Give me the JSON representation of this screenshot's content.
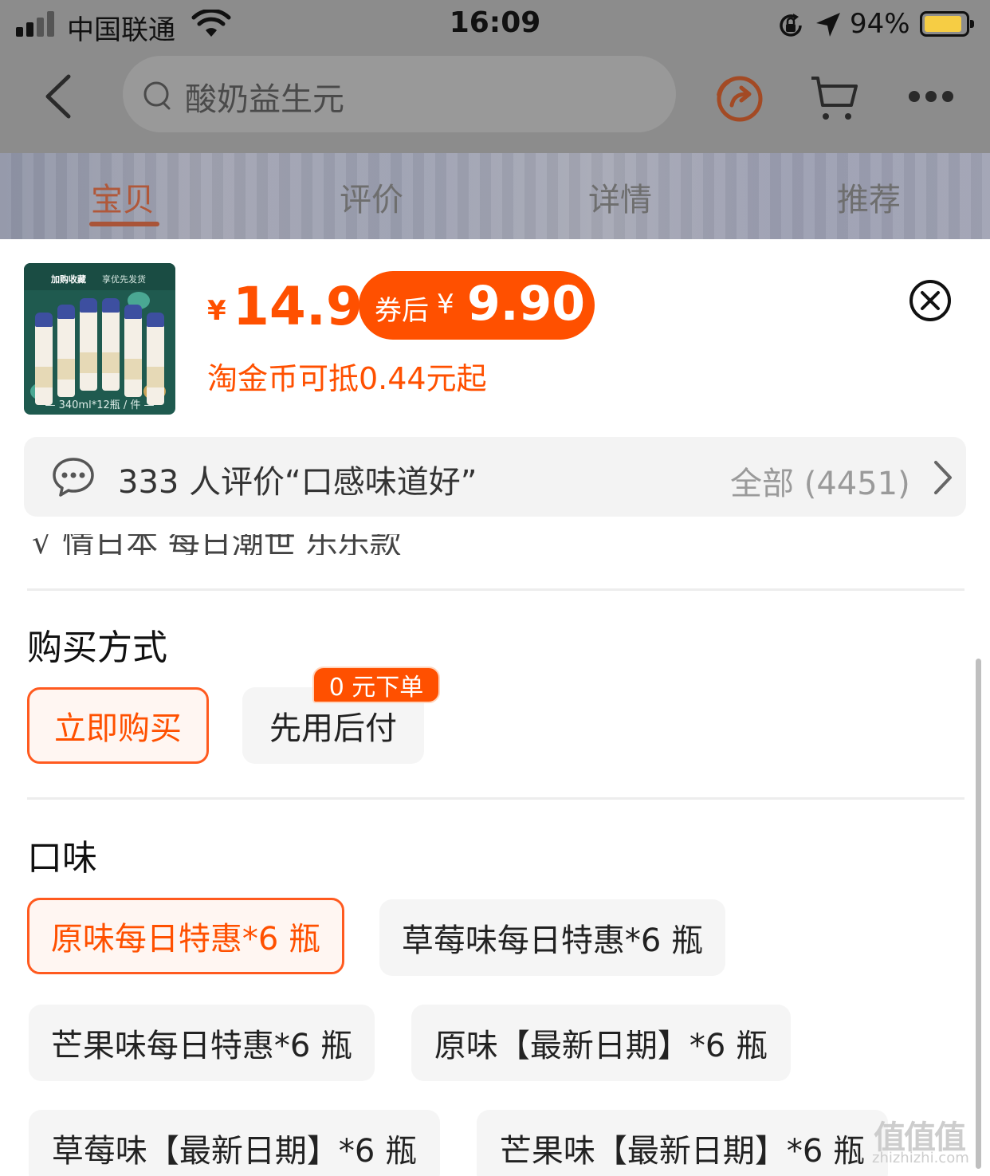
{
  "status_bar": {
    "carrier": "中国联通",
    "time": "16:09",
    "battery": "94%"
  },
  "nav": {
    "search_text": "酸奶益生元"
  },
  "tabs": [
    {
      "label": "宝贝",
      "active": true
    },
    {
      "label": "评价",
      "active": false
    },
    {
      "label": "详情",
      "active": false
    },
    {
      "label": "推荐",
      "active": false
    }
  ],
  "product": {
    "thumb_top": "加购收藏",
    "thumb_top2": "享优先发货",
    "thumb_caption": "— 340ml*12瓶 / 件 —",
    "yen": "¥",
    "price": "14.9",
    "coupon_label": "券后",
    "coupon_yen": "¥",
    "coupon_price": "9.90",
    "coin_text": "淘金币可抵0.44元起"
  },
  "review": {
    "summary": "333 人评价“口感味道好”",
    "all": "全部 (4451)"
  },
  "cut_row_text": "√ 情日本 每日潮世 乐乐款",
  "purchase": {
    "title": "购买方式",
    "options": [
      {
        "label": "立即购买",
        "selected": true
      },
      {
        "label": "先用后付",
        "selected": false
      }
    ],
    "badge": "0 元下单"
  },
  "flavor": {
    "title": "口味",
    "options": [
      {
        "label": "原味每日特惠*6 瓶",
        "selected": true
      },
      {
        "label": "草莓味每日特惠*6 瓶",
        "selected": false
      },
      {
        "label": "芒果味每日特惠*6 瓶",
        "selected": false
      },
      {
        "label": "原味【最新日期】*6 瓶",
        "selected": false
      },
      {
        "label": "草莓味【最新日期】*6 瓶",
        "selected": false
      },
      {
        "label": "芒果味【最新日期】*6 瓶",
        "selected": false
      }
    ]
  },
  "watermark": {
    "big": "值值值",
    "small": "zhizhizhi.com"
  },
  "colors": {
    "accent": "#ff5000",
    "coupon_bg": "#ff5000",
    "selected_bg": "#fff6f2"
  }
}
